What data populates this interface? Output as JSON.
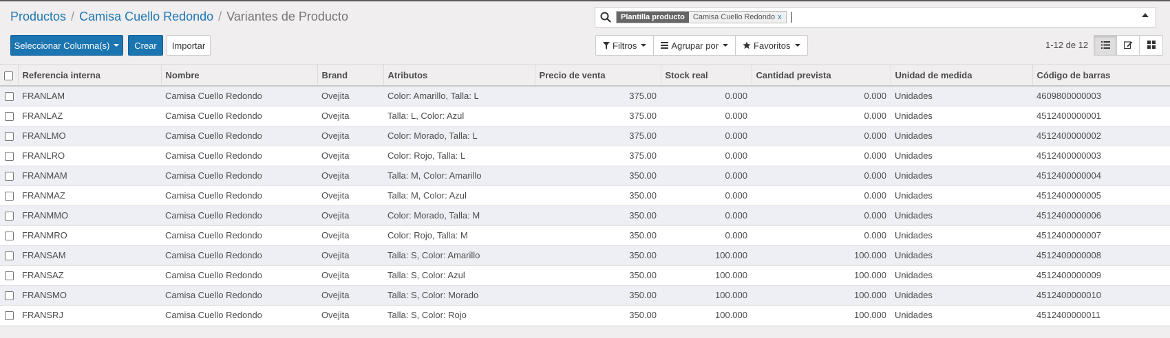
{
  "breadcrumb": {
    "items": [
      "Productos",
      "Camisa Cuello Redondo"
    ],
    "current": "Variantes de Producto"
  },
  "search": {
    "facet_name": "Plantilla producto",
    "facet_value": "Camisa Cuello Redondo",
    "facet_close": "x"
  },
  "toolbar": {
    "select_columns": "Seleccionar Columna(s)",
    "create": "Crear",
    "import": "Importar"
  },
  "filters": {
    "filters": "Filtros",
    "group_by": "Agrupar por",
    "favorites": "Favoritos"
  },
  "pager": {
    "value": "1-12 de 12"
  },
  "table": {
    "columns": [
      "Referencia interna",
      "Nombre",
      "Brand",
      "Atributos",
      "Precio de venta",
      "Stock real",
      "Cantidad prevista",
      "Unidad de medida",
      "Código de barras"
    ],
    "rows": [
      [
        "FRANLAM",
        "Camisa Cuello Redondo",
        "Ovejita",
        "Color: Amarillo, Talla: L",
        "375.00",
        "0.000",
        "0.000",
        "Unidades",
        "4609800000003"
      ],
      [
        "FRANLAZ",
        "Camisa Cuello Redondo",
        "Ovejita",
        "Talla: L, Color: Azul",
        "375.00",
        "0.000",
        "0.000",
        "Unidades",
        "4512400000001"
      ],
      [
        "FRANLMO",
        "Camisa Cuello Redondo",
        "Ovejita",
        "Color: Morado, Talla: L",
        "375.00",
        "0.000",
        "0.000",
        "Unidades",
        "4512400000002"
      ],
      [
        "FRANLRO",
        "Camisa Cuello Redondo",
        "Ovejita",
        "Color: Rojo, Talla: L",
        "375.00",
        "0.000",
        "0.000",
        "Unidades",
        "4512400000003"
      ],
      [
        "FRANMAM",
        "Camisa Cuello Redondo",
        "Ovejita",
        "Talla: M, Color: Amarillo",
        "350.00",
        "0.000",
        "0.000",
        "Unidades",
        "4512400000004"
      ],
      [
        "FRANMAZ",
        "Camisa Cuello Redondo",
        "Ovejita",
        "Talla: M, Color: Azul",
        "350.00",
        "0.000",
        "0.000",
        "Unidades",
        "4512400000005"
      ],
      [
        "FRANMMO",
        "Camisa Cuello Redondo",
        "Ovejita",
        "Color: Morado, Talla: M",
        "350.00",
        "0.000",
        "0.000",
        "Unidades",
        "4512400000006"
      ],
      [
        "FRANMRO",
        "Camisa Cuello Redondo",
        "Ovejita",
        "Color: Rojo, Talla: M",
        "350.00",
        "0.000",
        "0.000",
        "Unidades",
        "4512400000007"
      ],
      [
        "FRANSAM",
        "Camisa Cuello Redondo",
        "Ovejita",
        "Talla: S, Color: Amarillo",
        "350.00",
        "100.000",
        "100.000",
        "Unidades",
        "4512400000008"
      ],
      [
        "FRANSAZ",
        "Camisa Cuello Redondo",
        "Ovejita",
        "Talla: S, Color: Azul",
        "350.00",
        "100.000",
        "100.000",
        "Unidades",
        "4512400000009"
      ],
      [
        "FRANSMO",
        "Camisa Cuello Redondo",
        "Ovejita",
        "Talla: S, Color: Morado",
        "350.00",
        "100.000",
        "100.000",
        "Unidades",
        "4512400000010"
      ],
      [
        "FRANSRJ",
        "Camisa Cuello Redondo",
        "Ovejita",
        "Talla: S, Color: Rojo",
        "350.00",
        "100.000",
        "100.000",
        "Unidades",
        "4512400000011"
      ]
    ]
  },
  "colors": {
    "primary": "#1b75b0",
    "link": "#1f77b4",
    "row_odd": "#eeeef5",
    "panel_bg": "#f0eeee"
  }
}
